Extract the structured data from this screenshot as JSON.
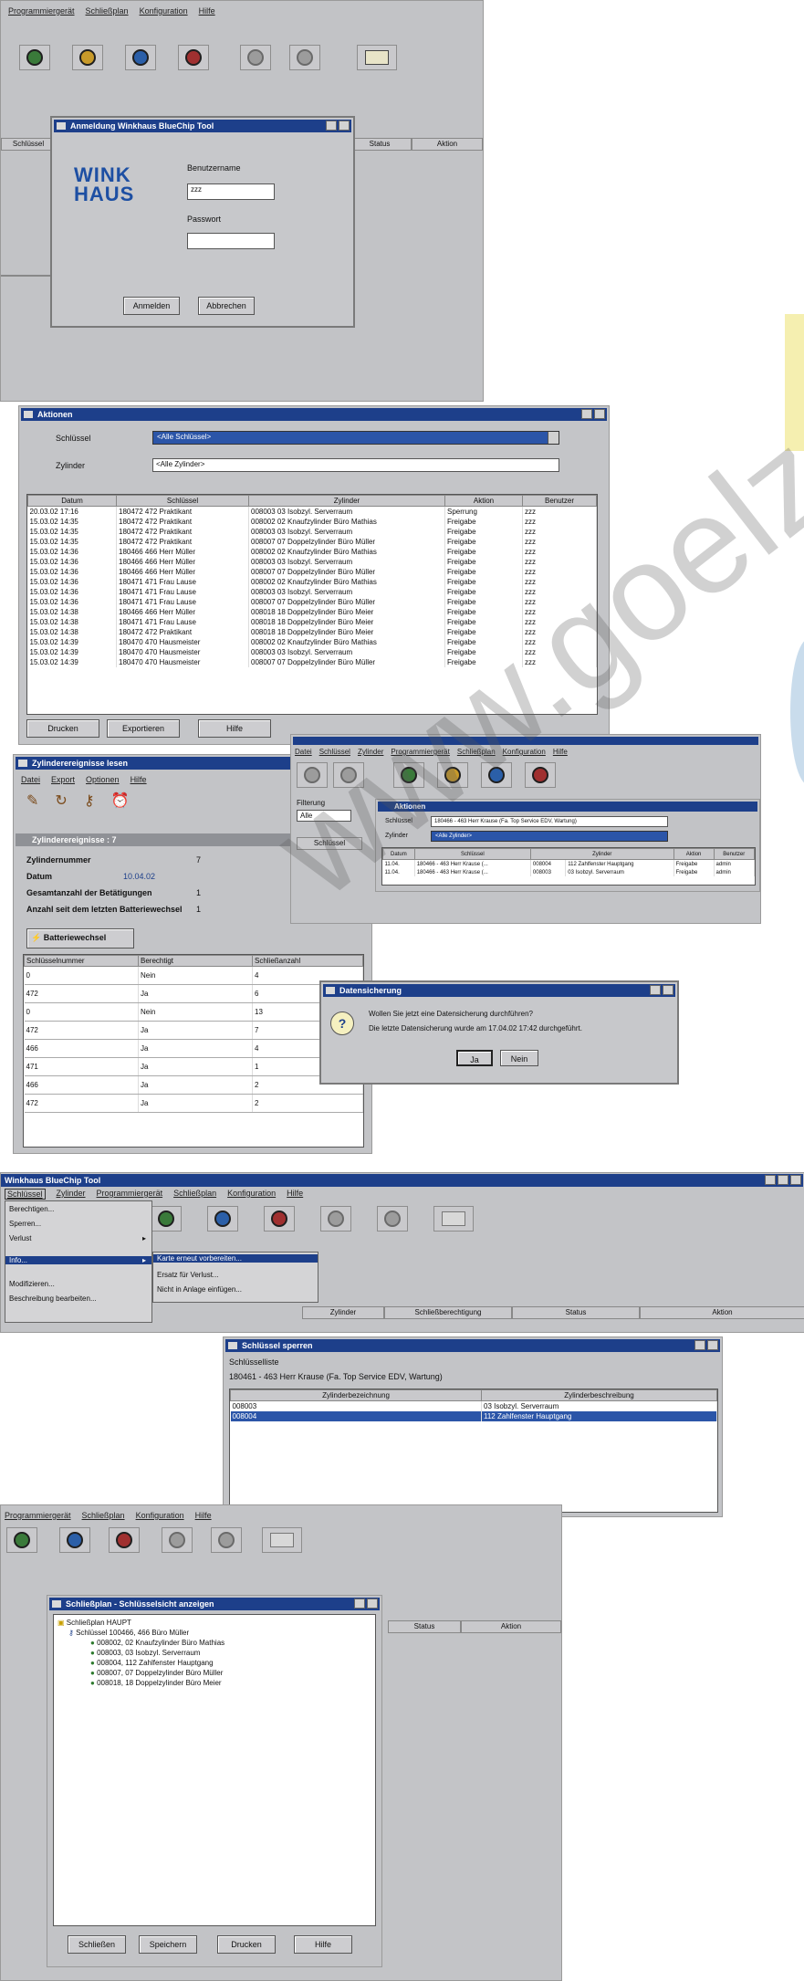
{
  "login_app": {
    "menu": [
      "Programmiergerät",
      "Schließplan",
      "Konfiguration",
      "Hilfe"
    ],
    "dialog": {
      "title": "Anmeldung Winkhaus BlueChip Tool",
      "logo_line1": "WINK",
      "logo_line2": "HAUS",
      "username_label": "Benutzername",
      "username_value": "zzz",
      "password_label": "Passwort",
      "password_value": "",
      "ok_button": "Anmelden",
      "cancel_button": "Abbrechen"
    },
    "column_headers": [
      "Schlüssel",
      "Status",
      "Aktion"
    ]
  },
  "events_window": {
    "title": "Aktionen",
    "key_label": "Schlüssel",
    "key_value": "<Alle Schlüssel>",
    "cylinder_label": "Zylinder",
    "cylinder_value": "<Alle Zylinder>",
    "columns": [
      "Datum",
      "Schlüssel",
      "Zylinder",
      "Aktion",
      "Benutzer"
    ],
    "rows": [
      [
        "20.03.02 17:16",
        "180472 472 Praktikant",
        "008003 03 Isobzyl. Serverraum",
        "Sperrung",
        "zzz"
      ],
      [
        "15.03.02 14:35",
        "180472 472 Praktikant",
        "008002 02 Knaufzylinder Büro Mathias",
        "Freigabe",
        "zzz"
      ],
      [
        "15.03.02 14:35",
        "180472 472 Praktikant",
        "008003 03 Isobzyl. Serverraum",
        "Freigabe",
        "zzz"
      ],
      [
        "15.03.02 14:35",
        "180472 472 Praktikant",
        "008007 07 Doppelzylinder Büro Müller",
        "Freigabe",
        "zzz"
      ],
      [
        "15.03.02 14:36",
        "180466 466 Herr Müller",
        "008002 02 Knaufzylinder Büro Mathias",
        "Freigabe",
        "zzz"
      ],
      [
        "15.03.02 14:36",
        "180466 466 Herr Müller",
        "008003 03 Isobzyl. Serverraum",
        "Freigabe",
        "zzz"
      ],
      [
        "15.03.02 14:36",
        "180466 466 Herr Müller",
        "008007 07 Doppelzylinder Büro Müller",
        "Freigabe",
        "zzz"
      ],
      [
        "15.03.02 14:36",
        "180471 471 Frau Lause",
        "008002 02 Knaufzylinder Büro Mathias",
        "Freigabe",
        "zzz"
      ],
      [
        "15.03.02 14:36",
        "180471 471 Frau Lause",
        "008003 03 Isobzyl. Serverraum",
        "Freigabe",
        "zzz"
      ],
      [
        "15.03.02 14:36",
        "180471 471 Frau Lause",
        "008007 07 Doppelzylinder Büro Müller",
        "Freigabe",
        "zzz"
      ],
      [
        "15.03.02 14:38",
        "180466 466 Herr Müller",
        "008018 18 Doppelzylinder Büro Meier",
        "Freigabe",
        "zzz"
      ],
      [
        "15.03.02 14:38",
        "180471 471 Frau Lause",
        "008018 18 Doppelzylinder Büro Meier",
        "Freigabe",
        "zzz"
      ],
      [
        "15.03.02 14:38",
        "180472 472 Praktikant",
        "008018 18 Doppelzylinder Büro Meier",
        "Freigabe",
        "zzz"
      ],
      [
        "15.03.02 14:39",
        "180470 470 Hausmeister",
        "008002 02 Knaufzylinder Büro Mathias",
        "Freigabe",
        "zzz"
      ],
      [
        "15.03.02 14:39",
        "180470 470 Hausmeister",
        "008003 03 Isobzyl. Serverraum",
        "Freigabe",
        "zzz"
      ],
      [
        "15.03.02 14:39",
        "180470 470 Hausmeister",
        "008007 07 Doppelzylinder Büro Müller",
        "Freigabe",
        "zzz"
      ]
    ],
    "buttons": [
      "Drucken",
      "Exportieren",
      "Hilfe"
    ]
  },
  "cylinder_reader": {
    "title": "Zylinderereignisse lesen",
    "menu": [
      "Datei",
      "Export",
      "Optionen",
      "Hilfe"
    ],
    "subtitle": "Zylinderereignisse : 7",
    "fields": [
      {
        "label": "Zylindernummer",
        "value": "7"
      },
      {
        "label": "Datum",
        "value": "10.04.02"
      },
      {
        "label": "Gesamtanzahl der Betätigungen",
        "value": "1"
      },
      {
        "label": "Anzahl seit dem letzten Batteriewechsel",
        "value": "1"
      }
    ],
    "battery_button": "Batteriewechsel",
    "columns": [
      "Schlüsselnummer",
      "Berechtigt",
      "Schließanzahl"
    ],
    "rows": [
      [
        "0",
        "Nein",
        "4"
      ],
      [
        "472",
        "Ja",
        "6"
      ],
      [
        "0",
        "Nein",
        "13"
      ],
      [
        "472",
        "Ja",
        "7"
      ],
      [
        "466",
        "Ja",
        "4"
      ],
      [
        "471",
        "Ja",
        "1"
      ],
      [
        "466",
        "Ja",
        "2"
      ],
      [
        "472",
        "Ja",
        "2"
      ]
    ]
  },
  "mini_app": {
    "menu": [
      "Datei",
      "Schlüssel",
      "Zylinder",
      "Programmiergerät",
      "Schließplan",
      "Konfiguration",
      "Hilfe"
    ],
    "side_label": "Filterung",
    "side_value": "Alle",
    "side_col": "Schlüssel",
    "actions": {
      "title": "Aktionen",
      "key_label": "Schlüssel",
      "key_value": "180466 - 463 Herr Krause (Fa. Top Service EDV, Wartung)",
      "cylinder_label": "Zylinder",
      "cylinder_value": "<Alle Zylinder>",
      "columns": [
        "Datum",
        "Schlüssel",
        "Zylinder",
        "Aktion",
        "Benutzer"
      ],
      "rows": [
        [
          "11.04.",
          "180466 - 463 Herr Krause (...",
          "008004",
          "112 Zahlfenster Hauptgang",
          "Freigabe",
          "admin"
        ],
        [
          "11.04.",
          "180466 - 463 Herr Krause (...",
          "008003",
          "03 Isobzyl. Serverraum",
          "Freigabe",
          "admin"
        ]
      ]
    }
  },
  "sync_dialog": {
    "title": "Datensicherung",
    "line1": "Wollen Sie jetzt eine Datensicherung durchführen?",
    "line2": "Die letzte Datensicherung wurde am 17.04.02 17:42 durchgeführt.",
    "yes_button": "Ja",
    "no_button": "Nein"
  },
  "main_app": {
    "title": "Winkhaus BlueChip Tool",
    "menu": [
      "Schlüssel",
      "Zylinder",
      "Programmiergerät",
      "Schließplan",
      "Konfiguration",
      "Hilfe"
    ],
    "dropdown_items": [
      "Berechtigen...",
      "Sperren...",
      "Verlust",
      "Info...",
      "Modifizieren...",
      "Beschreibung bearbeiten..."
    ],
    "submenu_items": [
      "Karte erneut vorbereiten...",
      "Ersatz für Verlust...",
      "Nicht in Anlage einfügen..."
    ],
    "column_headers": [
      "Zylinder",
      "Schließberechtigung",
      "Status",
      "Aktion"
    ]
  },
  "lock_window": {
    "title": "Schlüssel sperren",
    "key_label": "Schlüsselliste",
    "key_value": "180461 - 463 Herr Krause (Fa. Top Service EDV, Wartung)",
    "columns": [
      "Zylinderbezeichnung",
      "Zylinderbeschreibung"
    ],
    "rows": [
      [
        "008003",
        "03 Isobzyl. Serverraum"
      ],
      [
        "008004",
        "112 Zahlfenster Hauptgang"
      ]
    ]
  },
  "tree_app": {
    "menu": [
      "Programmiergerät",
      "Schließplan",
      "Konfiguration",
      "Hilfe"
    ],
    "dialog_title": "Schließplan - Schlüsselsicht anzeigen",
    "tree": [
      "Schließplan HAUPT",
      "Schlüssel 100466, 466 Büro Müller",
      "008002, 02 Knaufzylinder Büro Mathias",
      "008003, 03 Isobzyl. Serverraum",
      "008004, 112 Zahlfenster Hauptgang",
      "008007, 07 Doppelzylinder Büro Müller",
      "008018, 18 Doppelzylinder Büro Meier"
    ],
    "column_headers": [
      "Status",
      "Aktion"
    ],
    "buttons": [
      "Schließen",
      "Speichern",
      "Drucken",
      "Hilfe"
    ]
  },
  "watermark": "www.goelz"
}
